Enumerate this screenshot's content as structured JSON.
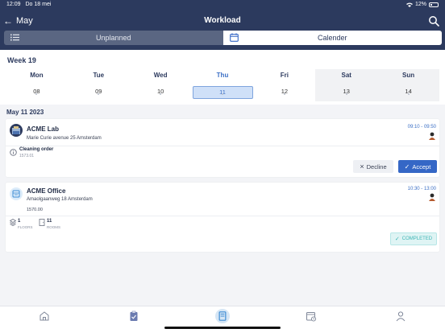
{
  "status": {
    "time": "12:09",
    "date": "Do 18 mei",
    "battery": "12%"
  },
  "nav": {
    "back_label": "May",
    "title": "Workload"
  },
  "segments": {
    "unplanned": "Unplanned",
    "calendar": "Calender"
  },
  "week": {
    "title": "Week 19",
    "days": [
      {
        "name": "Mon",
        "num": "08"
      },
      {
        "name": "Tue",
        "num": "09"
      },
      {
        "name": "Wed",
        "num": "10"
      },
      {
        "name": "Thu",
        "num": "11"
      },
      {
        "name": "Fri",
        "num": "12"
      },
      {
        "name": "Sat",
        "num": "13"
      },
      {
        "name": "Sun",
        "num": "14"
      }
    ]
  },
  "date_heading": "May 11 2023",
  "cards": [
    {
      "title": "ACME Lab",
      "address": "Marie Curie avenue 25 Amsterdam",
      "time": "09:10 - 09:50",
      "task_label": "Cleaning order",
      "task_code": "1573.01",
      "decline_label": "Decline",
      "accept_label": "Accept"
    },
    {
      "title": "ACME Office",
      "address": "Amaolgaanweg 18 Amsterdam",
      "time": "10:30 - 13:00",
      "code": "1570.00",
      "floors_count": "1",
      "floors_label": "FLOORS",
      "rooms_count": "11",
      "rooms_label": "ROOMS",
      "status_label": "COMPLETED"
    }
  ],
  "colors": {
    "header": "#2c3a5e",
    "accent": "#3567c6",
    "completed": "#3fb6b6"
  }
}
